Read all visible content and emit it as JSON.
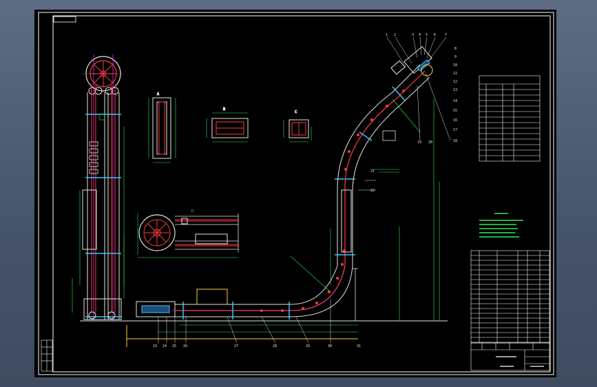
{
  "drawing": {
    "corner_tag": "",
    "part_numbers_top": [
      "1",
      "2",
      "3",
      "4",
      "5",
      "6",
      "7"
    ],
    "part_numbers_right": [
      "8",
      "9",
      "10",
      "11",
      "12",
      "13",
      "14",
      "15",
      "16",
      "17",
      "18"
    ],
    "part_numbers_mid": [
      "19",
      "20",
      "21",
      "22"
    ],
    "part_numbers_bottom": [
      "23",
      "24",
      "25",
      "26",
      "27",
      "28",
      "29",
      "30",
      "31"
    ]
  },
  "colors": {
    "sheet": "#000000",
    "frame": "#ffffff",
    "structure": "#e8e8e8",
    "chain": "#ff3b3b",
    "centerline": "#ff3bff",
    "dimension": "#2eea5c",
    "accent": "#3ec4ff",
    "hatch": "#ffd23f"
  }
}
